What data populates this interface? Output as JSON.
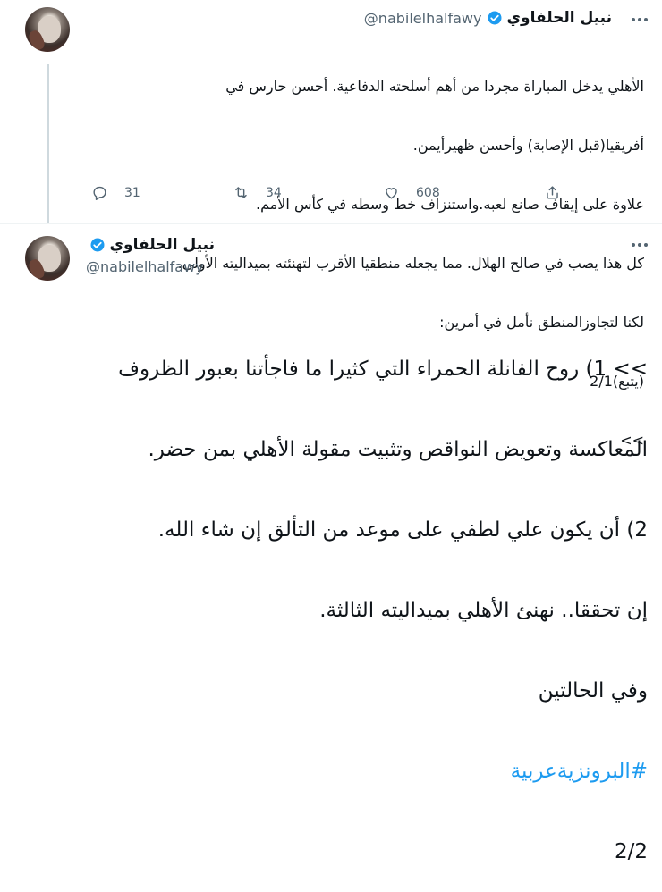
{
  "tweet1": {
    "display_name": "نبيل الحلفاوي",
    "handle": "@nabilelhalfawy",
    "lines": [
      "الأهلي يدخل المباراة مجردا من أهم أسلحته الدفاعية. أحسن حارس في",
      "أفريقيا(قبل الإصابة) وأحسن ظهيرأيمن.",
      "علاوة على إيقاف صانع لعبه.واستنزاف خط وسطه في كأس الأمم.",
      "كل هذا يصب في صالح الهلال. مما يجعله منطقيا الأقرب لتهنئته بميداليته الأولى.",
      "لكنا لتجاوزالمنطق نأمل في أمرين:",
      "(يتبع)2/1",
      ">>"
    ],
    "actions": {
      "replies": "31",
      "retweets": "34",
      "likes": "608"
    }
  },
  "tweet2": {
    "display_name": "نبيل الحلفاوي",
    "handle": "@nabilelhalfawy",
    "lines": [
      ">> 1) روح الفانلة الحمراء التي كثيرا ما فاجأتنا بعبور الظروف",
      "المعاكسة وتعويض النواقص وتثبيت مقولة الأهلي بمن حضر.",
      "2) أن يكون علي لطفي على موعد من التألق إن شاء الله.",
      "إن تحققا.. نهنئ الأهلي بميداليته الثالثة.",
      "وفي الحالتين",
      "2/2"
    ],
    "hashtag": "#البرونزيةعربية"
  },
  "colors": {
    "accent": "#1d9bf0",
    "muted": "#536471",
    "text": "#0f1419"
  },
  "icons": [
    "more-icon",
    "verified-icon",
    "reply-icon",
    "retweet-icon",
    "like-icon",
    "share-icon"
  ]
}
